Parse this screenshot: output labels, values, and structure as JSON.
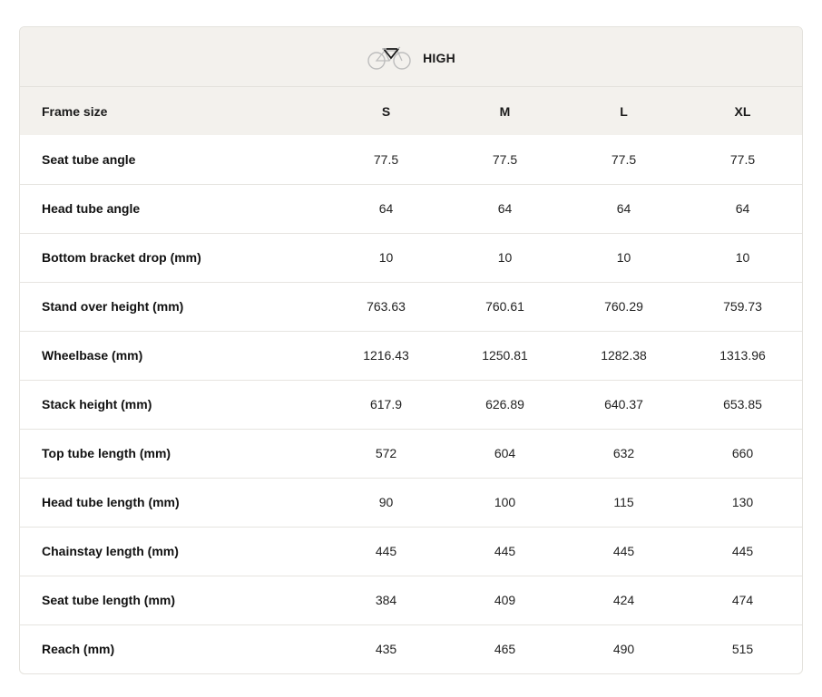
{
  "header": {
    "title": "HIGH",
    "icon": "bicycle-icon"
  },
  "table": {
    "label_header": "Frame size",
    "sizes": [
      "S",
      "M",
      "L",
      "XL"
    ],
    "rows": [
      {
        "label": "Seat tube angle",
        "values": [
          "77.5",
          "77.5",
          "77.5",
          "77.5"
        ]
      },
      {
        "label": "Head tube angle",
        "values": [
          "64",
          "64",
          "64",
          "64"
        ]
      },
      {
        "label": "Bottom bracket drop (mm)",
        "values": [
          "10",
          "10",
          "10",
          "10"
        ]
      },
      {
        "label": "Stand over height (mm)",
        "values": [
          "763.63",
          "760.61",
          "760.29",
          "759.73"
        ]
      },
      {
        "label": "Wheelbase (mm)",
        "values": [
          "1216.43",
          "1250.81",
          "1282.38",
          "1313.96"
        ]
      },
      {
        "label": "Stack height (mm)",
        "values": [
          "617.9",
          "626.89",
          "640.37",
          "653.85"
        ]
      },
      {
        "label": "Top tube length (mm)",
        "values": [
          "572",
          "604",
          "632",
          "660"
        ]
      },
      {
        "label": "Head tube length (mm)",
        "values": [
          "90",
          "100",
          "115",
          "130"
        ]
      },
      {
        "label": "Chainstay length (mm)",
        "values": [
          "445",
          "445",
          "445",
          "445"
        ]
      },
      {
        "label": "Seat tube length (mm)",
        "values": [
          "384",
          "409",
          "424",
          "474"
        ]
      },
      {
        "label": "Reach (mm)",
        "values": [
          "435",
          "465",
          "490",
          "515"
        ]
      }
    ]
  },
  "colors": {
    "header_bg": "#f3f1ed",
    "border": "#e4e2dd",
    "text": "#1a1a1a"
  }
}
